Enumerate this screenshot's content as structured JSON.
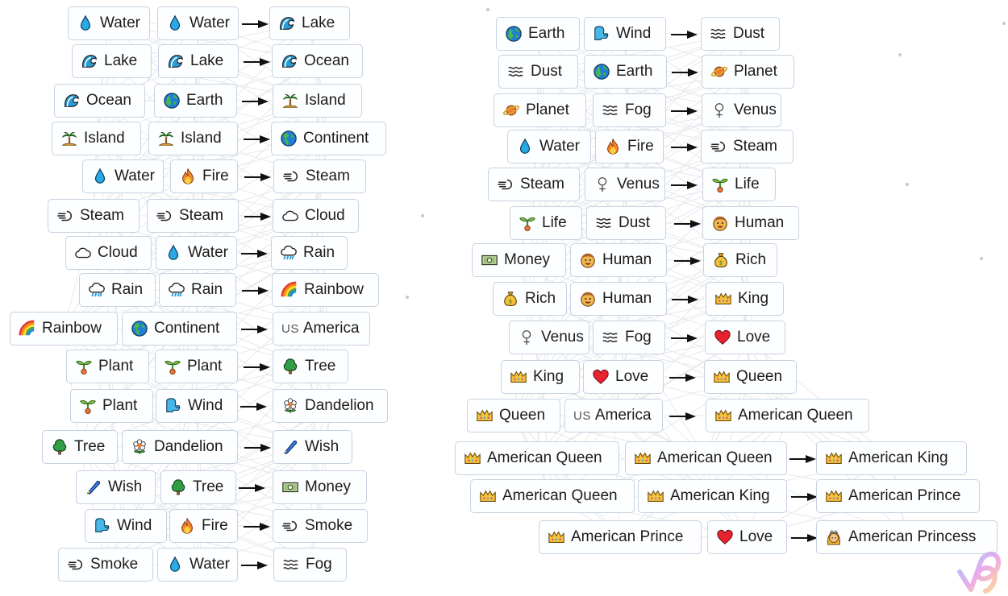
{
  "canvas": {
    "theme": {
      "chip_border": "#c7d2e0",
      "chip_background": "#fdfeff",
      "text": "#1c1c1c",
      "arrow": "#111111"
    },
    "recipes_left": [
      {
        "a": {
          "label": "Water",
          "icon": "water-drop"
        },
        "b": {
          "label": "Water",
          "icon": "water-drop"
        },
        "result": {
          "label": "Lake",
          "icon": "wave"
        }
      },
      {
        "a": {
          "label": "Lake",
          "icon": "wave"
        },
        "b": {
          "label": "Lake",
          "icon": "wave"
        },
        "result": {
          "label": "Ocean",
          "icon": "wave"
        }
      },
      {
        "a": {
          "label": "Ocean",
          "icon": "wave"
        },
        "b": {
          "label": "Earth",
          "icon": "globe"
        },
        "result": {
          "label": "Island",
          "icon": "palm-island"
        }
      },
      {
        "a": {
          "label": "Island",
          "icon": "palm-island"
        },
        "b": {
          "label": "Island",
          "icon": "palm-island"
        },
        "result": {
          "label": "Continent",
          "icon": "globe-americas"
        }
      },
      {
        "a": {
          "label": "Water",
          "icon": "water-drop"
        },
        "b": {
          "label": "Fire",
          "icon": "fire"
        },
        "result": {
          "label": "Steam",
          "icon": "dash-cloud"
        }
      },
      {
        "a": {
          "label": "Steam",
          "icon": "dash-cloud"
        },
        "b": {
          "label": "Steam",
          "icon": "dash-cloud"
        },
        "result": {
          "label": "Cloud",
          "icon": "cloud"
        }
      },
      {
        "a": {
          "label": "Cloud",
          "icon": "cloud"
        },
        "b": {
          "label": "Water",
          "icon": "water-drop"
        },
        "result": {
          "label": "Rain",
          "icon": "rain-cloud"
        }
      },
      {
        "a": {
          "label": "Rain",
          "icon": "rain-cloud"
        },
        "b": {
          "label": "Rain",
          "icon": "rain-cloud"
        },
        "result": {
          "label": "Rainbow",
          "icon": "rainbow"
        }
      },
      {
        "a": {
          "label": "Rainbow",
          "icon": "rainbow"
        },
        "b": {
          "label": "Continent",
          "icon": "globe-americas"
        },
        "result": {
          "label": "America",
          "icon": "us-flag-text",
          "icon_text": "US"
        }
      },
      {
        "a": {
          "label": "Plant",
          "icon": "seedling"
        },
        "b": {
          "label": "Plant",
          "icon": "seedling"
        },
        "result": {
          "label": "Tree",
          "icon": "tree"
        }
      },
      {
        "a": {
          "label": "Plant",
          "icon": "seedling"
        },
        "b": {
          "label": "Wind",
          "icon": "wind-face"
        },
        "result": {
          "label": "Dandelion",
          "icon": "flower"
        }
      },
      {
        "a": {
          "label": "Tree",
          "icon": "tree"
        },
        "b": {
          "label": "Dandelion",
          "icon": "flower"
        },
        "result": {
          "label": "Wish",
          "icon": "shooting-star"
        }
      },
      {
        "a": {
          "label": "Wish",
          "icon": "shooting-star"
        },
        "b": {
          "label": "Tree",
          "icon": "tree"
        },
        "result": {
          "label": "Money",
          "icon": "banknote"
        }
      },
      {
        "a": {
          "label": "Wind",
          "icon": "wind-face"
        },
        "b": {
          "label": "Fire",
          "icon": "fire"
        },
        "result": {
          "label": "Smoke",
          "icon": "dash-cloud"
        }
      },
      {
        "a": {
          "label": "Smoke",
          "icon": "dash-cloud"
        },
        "b": {
          "label": "Water",
          "icon": "water-drop"
        },
        "result": {
          "label": "Fog",
          "icon": "fog"
        }
      }
    ],
    "recipes_right": [
      {
        "a": {
          "label": "Earth",
          "icon": "globe"
        },
        "b": {
          "label": "Wind",
          "icon": "wind-face"
        },
        "result": {
          "label": "Dust",
          "icon": "fog"
        }
      },
      {
        "a": {
          "label": "Dust",
          "icon": "fog"
        },
        "b": {
          "label": "Earth",
          "icon": "globe"
        },
        "result": {
          "label": "Planet",
          "icon": "ringed-planet"
        }
      },
      {
        "a": {
          "label": "Planet",
          "icon": "ringed-planet"
        },
        "b": {
          "label": "Fog",
          "icon": "fog"
        },
        "result": {
          "label": "Venus",
          "icon": "female-sign"
        }
      },
      {
        "a": {
          "label": "Water",
          "icon": "water-drop"
        },
        "b": {
          "label": "Fire",
          "icon": "fire"
        },
        "result": {
          "label": "Steam",
          "icon": "dash-cloud"
        }
      },
      {
        "a": {
          "label": "Steam",
          "icon": "dash-cloud"
        },
        "b": {
          "label": "Venus",
          "icon": "female-sign"
        },
        "result": {
          "label": "Life",
          "icon": "seedling"
        }
      },
      {
        "a": {
          "label": "Life",
          "icon": "seedling"
        },
        "b": {
          "label": "Dust",
          "icon": "fog"
        },
        "result": {
          "label": "Human",
          "icon": "face"
        }
      },
      {
        "a": {
          "label": "Money",
          "icon": "banknote"
        },
        "b": {
          "label": "Human",
          "icon": "face"
        },
        "result": {
          "label": "Rich",
          "icon": "money-bag"
        }
      },
      {
        "a": {
          "label": "Rich",
          "icon": "money-bag"
        },
        "b": {
          "label": "Human",
          "icon": "face"
        },
        "result": {
          "label": "King",
          "icon": "crown"
        }
      },
      {
        "a": {
          "label": "Venus",
          "icon": "female-sign"
        },
        "b": {
          "label": "Fog",
          "icon": "fog"
        },
        "result": {
          "label": "Love",
          "icon": "heart"
        }
      },
      {
        "a": {
          "label": "King",
          "icon": "crown"
        },
        "b": {
          "label": "Love",
          "icon": "heart"
        },
        "result": {
          "label": "Queen",
          "icon": "crown"
        }
      },
      {
        "a": {
          "label": "Queen",
          "icon": "crown"
        },
        "b": {
          "label": "America",
          "icon": "us-flag-text",
          "icon_text": "US"
        },
        "result": {
          "label": "American Queen",
          "icon": "crown"
        }
      },
      {
        "a": {
          "label": "American Queen",
          "icon": "crown"
        },
        "b": {
          "label": "American Queen",
          "icon": "crown"
        },
        "result": {
          "label": "American King",
          "icon": "crown"
        }
      },
      {
        "a": {
          "label": "American Queen",
          "icon": "crown"
        },
        "b": {
          "label": "American King",
          "icon": "crown"
        },
        "result": {
          "label": "American Prince",
          "icon": "crown"
        }
      },
      {
        "a": {
          "label": "American Prince",
          "icon": "crown"
        },
        "b": {
          "label": "Love",
          "icon": "heart"
        },
        "result": {
          "label": "American Princess",
          "icon": "princess"
        }
      }
    ]
  }
}
